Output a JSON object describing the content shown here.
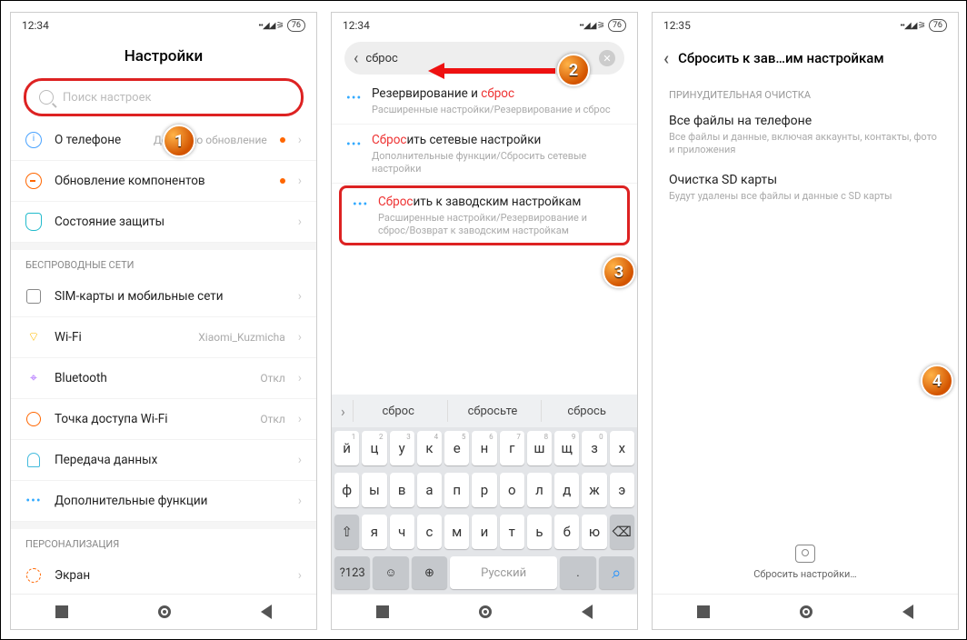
{
  "p1": {
    "time": "12:34",
    "batt": "76",
    "title": "Настройки",
    "search_placeholder": "Поиск настроек",
    "r_about": "О телефоне",
    "r_about_val": "Доступно обновление",
    "r_comp": "Обновление компонентов",
    "r_sec": "Состояние защиты",
    "sec_wireless": "БЕСПРОВОДНЫЕ СЕТИ",
    "r_sim": "SIM-карты и мобильные сети",
    "r_wifi": "Wi-Fi",
    "r_wifi_val": "Xiaomi_Kuzmicha",
    "r_bt": "Bluetooth",
    "r_bt_val": "Откл",
    "r_hs": "Точка доступа Wi-Fi",
    "r_hs_val": "Откл",
    "r_data": "Передача данных",
    "r_more": "Дополнительные функции",
    "sec_pers": "ПЕРСОНАЛИЗАЦИЯ",
    "r_screen": "Экран"
  },
  "p2": {
    "time": "12:34",
    "batt": "76",
    "query": "сброс",
    "res1": {
      "pre": "Резервирование и ",
      "hl": "сброс",
      "post": "",
      "sub": "Расширенные настройки/Резервирование и сброс"
    },
    "res2": {
      "hl": "Сброс",
      "post": "ить сетевые настройки",
      "sub": "Дополнительные функции/Сбросить сетевые настройки"
    },
    "res3": {
      "hl": "Сброс",
      "post": "ить к заводским настройкам",
      "sub": "Расширенные настройки/Резервирование и сброс/Возврат к заводским настройкам"
    },
    "sugg": [
      "сброс",
      "сбросьте",
      "сбрось"
    ],
    "row1": [
      [
        "й",
        "1"
      ],
      [
        "ц",
        "2"
      ],
      [
        "у",
        "3"
      ],
      [
        "к",
        "4"
      ],
      [
        "е",
        "5"
      ],
      [
        "н",
        "6"
      ],
      [
        "г",
        "7"
      ],
      [
        "ш",
        "8"
      ],
      [
        "щ",
        "9"
      ],
      [
        "з",
        "0"
      ],
      [
        "х",
        ""
      ]
    ],
    "row2": [
      "ф",
      "ы",
      "в",
      "а",
      "п",
      "р",
      "о",
      "л",
      "д",
      "ж",
      "э"
    ],
    "row3": [
      "я",
      "ч",
      "с",
      "м",
      "и",
      "т",
      "ь",
      "б",
      "ю"
    ],
    "kb_num": "?123",
    "kb_lang": "Русский"
  },
  "p3": {
    "time": "12:35",
    "batt": "76",
    "title": "Сбросить к зав…им настройкам",
    "sec": "ПРИНУДИТЕЛЬНАЯ ОЧИСТКА",
    "i1_t": "Все файлы на телефоне",
    "i1_s": "Все файлы и данные, включая аккаунты, контакты, фото и приложения",
    "i2_t": "Очистка SD карты",
    "i2_s": "Будут удалены все файлы и данные с SD карты",
    "btn": "Сбросить настройки…"
  },
  "badges": {
    "b1": "1",
    "b2": "2",
    "b3": "3",
    "b4": "4"
  }
}
